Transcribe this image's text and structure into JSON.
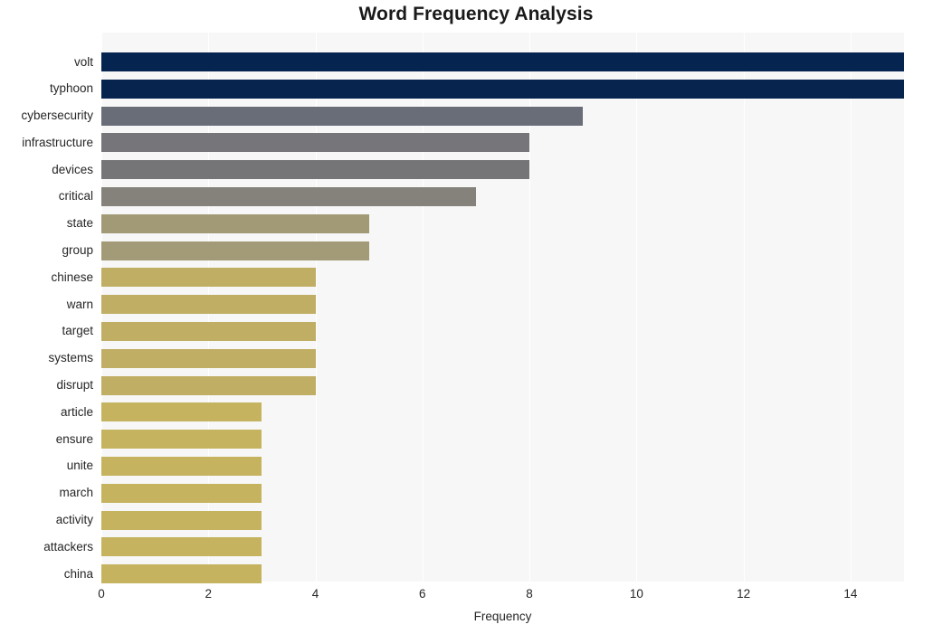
{
  "chart_data": {
    "type": "bar",
    "orientation": "horizontal",
    "title": "Word Frequency Analysis",
    "xlabel": "Frequency",
    "ylabel": "",
    "xlim": [
      0,
      15
    ],
    "xticks": [
      0,
      2,
      4,
      6,
      8,
      10,
      12,
      14
    ],
    "xtick_labels": [
      "0",
      "2",
      "4",
      "6",
      "8",
      "10",
      "12",
      "14"
    ],
    "grid": true,
    "grid_axis": "x",
    "legend": null,
    "categories": [
      "volt",
      "typhoon",
      "cybersecurity",
      "infrastructure",
      "devices",
      "critical",
      "state",
      "group",
      "chinese",
      "warn",
      "target",
      "systems",
      "disrupt",
      "article",
      "ensure",
      "unite",
      "march",
      "activity",
      "attackers",
      "china"
    ],
    "values": [
      15,
      15,
      9,
      8,
      8,
      7,
      5,
      5,
      4,
      4,
      4,
      4,
      4,
      3,
      3,
      3,
      3,
      3,
      3,
      3
    ],
    "bar_colors": [
      "#05244f",
      "#06244e",
      "#696d77",
      "#75757a",
      "#757578",
      "#84827a",
      "#a29a77",
      "#a39b77",
      "#bfae64",
      "#bfae64",
      "#bfae64",
      "#bfae64",
      "#bfae64",
      "#c5b35f",
      "#c5b35f",
      "#c5b35f",
      "#c5b35f",
      "#c5b35f",
      "#c5b35f",
      "#c5b35f"
    ],
    "plot_background": "#f7f7f7",
    "gridline_color": "#ffffff",
    "figure_background": "#ffffff",
    "text_color": "#262626"
  }
}
